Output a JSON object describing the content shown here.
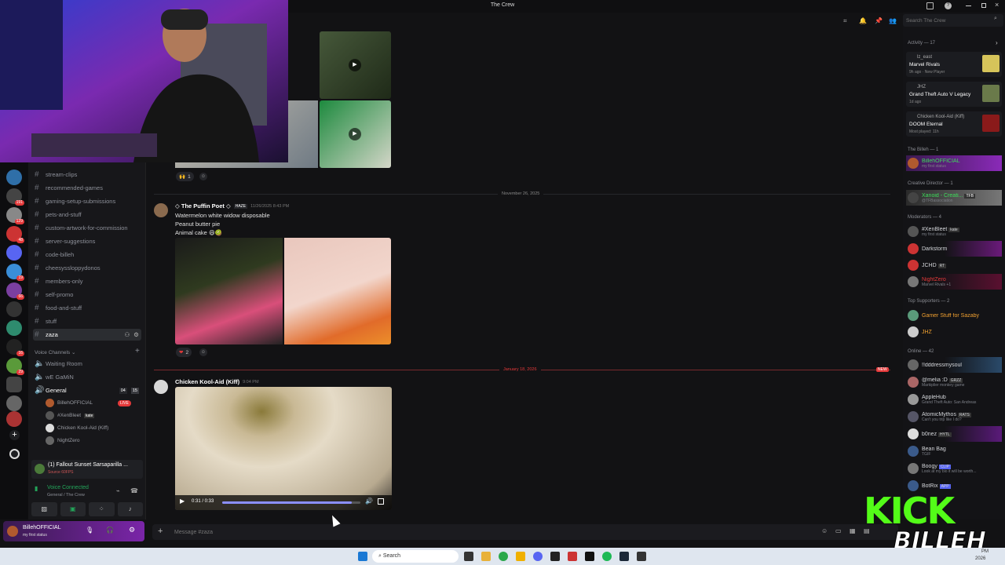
{
  "window": {
    "title": "The Crew"
  },
  "search": {
    "placeholder": "Search The Crew"
  },
  "channels": [
    "stream-clips",
    "recommended-games",
    "gaming-setup-submissions",
    "pets-and-stuff",
    "custom-artwork-for-commission",
    "server-suggestions",
    "code-billeh",
    "cheesyssloppydonos",
    "members-only",
    "self-promo",
    "food-and-stuff",
    "stuff",
    "zaza"
  ],
  "voice": {
    "header": "Voice Channels",
    "channels": [
      "Waiting Room",
      "wE GaMiN",
      "General"
    ],
    "general_count": "04",
    "general_limit": "15",
    "users": [
      "BillehOFFICIAL",
      "#XenBleet",
      "Chicken Kool-Aid (Kiff)",
      "NightZero"
    ],
    "live_badge": "LIVE",
    "tag_kate": "kate"
  },
  "activity_panel": {
    "title": "(1) Fallout Sunset Sarsaparilla ...",
    "sub": "Source 60FPS"
  },
  "voice_status": {
    "label": "Voice Connected",
    "sub": "General / The Crew"
  },
  "user": {
    "name": "BillehOFFICIAL",
    "status": "my first status"
  },
  "messages": {
    "reaction1": "1",
    "puffin": {
      "name": "The Puffin Poet",
      "tag": "HAZE",
      "time": "11/26/2025 8:43 PM",
      "lines": [
        "Watermelon white widow disposable",
        "Peanut butter pie",
        "Animal cake"
      ]
    },
    "reaction2": "2",
    "chicken": {
      "name": "Chicken Kool-Aid (Kiff)",
      "time": "9:04 PM"
    },
    "video": {
      "time": "0:31 / 0:33",
      "progress": 0.94
    }
  },
  "dates": {
    "nov": "November 26, 2025",
    "jan": "January 18, 2026",
    "new": "NEW"
  },
  "input": {
    "placeholder": "Message #zaza"
  },
  "members": {
    "activity_header": "Activity — 17",
    "activities": [
      {
        "user": "lz_east",
        "game": "Marvel Rivals",
        "meta": "9h ago · New Player"
      },
      {
        "user": "JHZ",
        "game": "Grand Theft Auto V Legacy",
        "meta": "1d ago"
      },
      {
        "user": "Chicken Kool-Aid (Kiff)",
        "game": "DOOM Eternal",
        "meta": "Most played: 11h"
      }
    ],
    "sections": [
      "The Billeh — 1",
      "Creative Director — 1",
      "Moderators — 4",
      "Top Supporters — 2",
      "Online — 42"
    ],
    "billeh": {
      "name": "BillehOFFICIAL",
      "status": "my first status"
    },
    "creative": {
      "name": "Xanoid - Creati...",
      "tag": "TFB",
      "status": "@TFBassociation"
    },
    "mods": [
      {
        "name": "#XenBleet",
        "tag": "kate",
        "status": "my first status"
      },
      {
        "name": "Darkstorm",
        "tag": "",
        "status": ""
      },
      {
        "name": "JCHD",
        "tag": "RT",
        "status": ""
      },
      {
        "name": "NightZero",
        "tag": "",
        "status": "Marvel Rivals +1"
      }
    ],
    "supporters": [
      "Gamer Stuff for Sazaby",
      "JHZ"
    ],
    "online": [
      {
        "name": "!!dddressmysoul",
        "tag": "",
        "status": ""
      },
      {
        "name": "@melia :D",
        "tag": "GRZZ",
        "status": "Markiplier monkey game"
      },
      {
        "name": "AppleHub",
        "tag": "",
        "status": "Grand Theft Auto: San Andreas"
      },
      {
        "name": "AtomicMythos",
        "tag": "RATS",
        "status": "Can't you trip like I do?"
      },
      {
        "name": "b0nez",
        "tag": "HYTL",
        "status": ""
      },
      {
        "name": "Bean Bag",
        "tag": "",
        "status": "TGIF"
      },
      {
        "name": "Boogy",
        "tag": "CLIP",
        "status": "Look at my bio it will be worth..."
      },
      {
        "name": "BotRix",
        "tag": "APP",
        "status": ""
      }
    ]
  },
  "overlay": {
    "line1": "KICK",
    "line2": "BILLEH"
  },
  "taskbar": {
    "search": "Search",
    "clock_time": "PM",
    "clock_date": "2026"
  }
}
